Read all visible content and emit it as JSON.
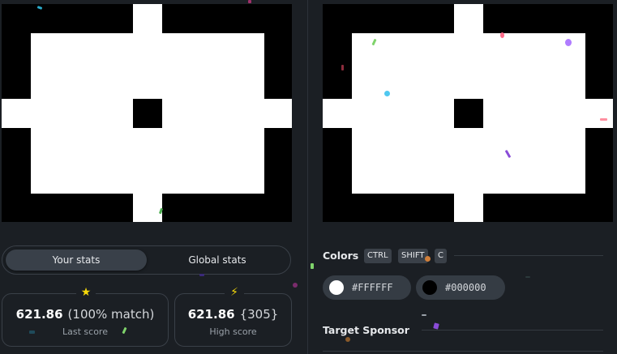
{
  "stats_tabs": {
    "your_stats": "Your stats",
    "global_stats": "Global stats"
  },
  "last_score": {
    "value": "621.86",
    "detail": "(100% match)",
    "label": "Last score",
    "icon": "star-icon"
  },
  "high_score": {
    "value": "621.86",
    "detail": "{305}",
    "label": "High score",
    "icon": "lightning-icon"
  },
  "colors": {
    "title": "Colors",
    "shortcut": [
      "CTRL",
      "SHIFT",
      "C"
    ],
    "swatches": [
      {
        "hex_label": "#FFFFFF",
        "color": "#FFFFFF"
      },
      {
        "hex_label": "#000000",
        "color": "#000000"
      }
    ]
  },
  "target_sponsor": {
    "title": "Target Sponsor"
  }
}
